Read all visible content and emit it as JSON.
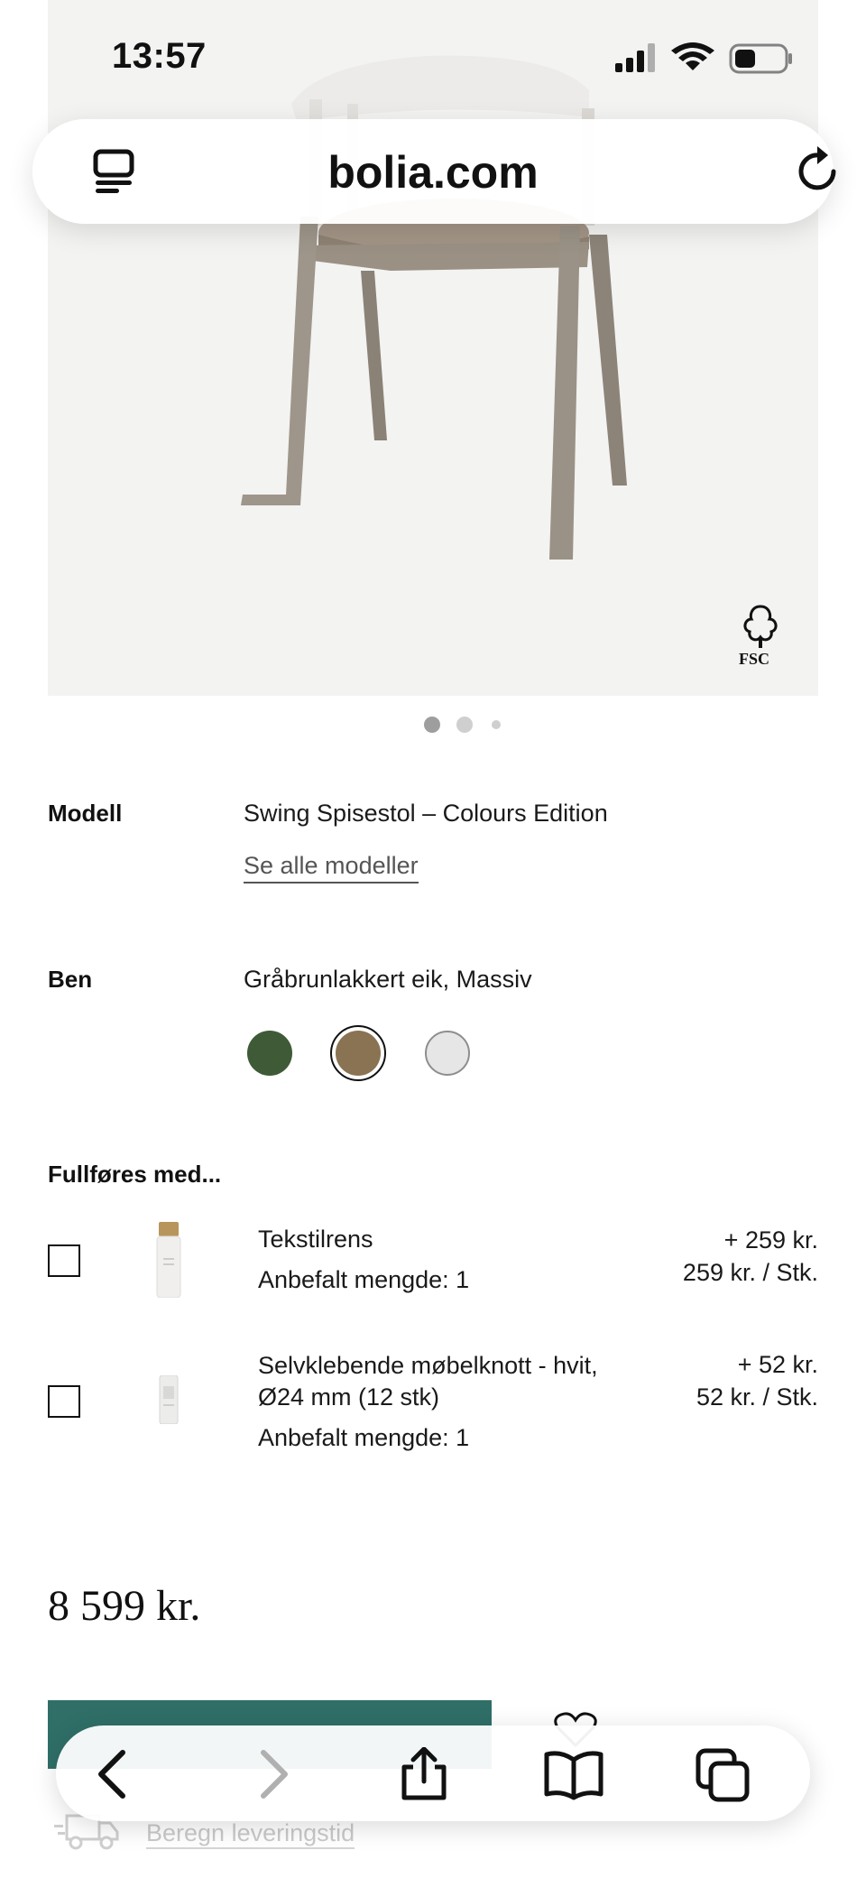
{
  "status_bar": {
    "time": "13:57"
  },
  "browser": {
    "domain": "bolia.com"
  },
  "product": {
    "model_label": "Modell",
    "model_value": "Swing Spisestol – Colours Edition",
    "see_all_models": "Se alle modeller",
    "legs_label": "Ben",
    "legs_value": "Gråbrunlakkert eik, Massiv",
    "swatches": [
      {
        "name": "green",
        "color": "#3f5a37"
      },
      {
        "name": "brown",
        "color": "#8a7352",
        "selected": true
      },
      {
        "name": "light-grey",
        "color": "#e6e6e6"
      }
    ],
    "certification": "FSC"
  },
  "complete_with": {
    "title": "Fullføres med...",
    "items": [
      {
        "name": "Tekstilrens",
        "recommended": "Anbefalt mengde: 1",
        "price_add": "+ 259 kr.",
        "unit_price": "259 kr. / Stk."
      },
      {
        "name_line1": "Selvklebende møbelknott - hvit,",
        "name_line2": "Ø24 mm (12 stk)",
        "recommended": "Anbefalt mengde: 1",
        "price_add": "+ 52 kr.",
        "unit_price": "52 kr. / Stk."
      }
    ]
  },
  "price": "8 599 kr.",
  "delivery_link": "Beregn leveringstid",
  "carousel": {
    "count": 3,
    "active": 1
  },
  "colors": {
    "accent": "#2f6f68"
  }
}
